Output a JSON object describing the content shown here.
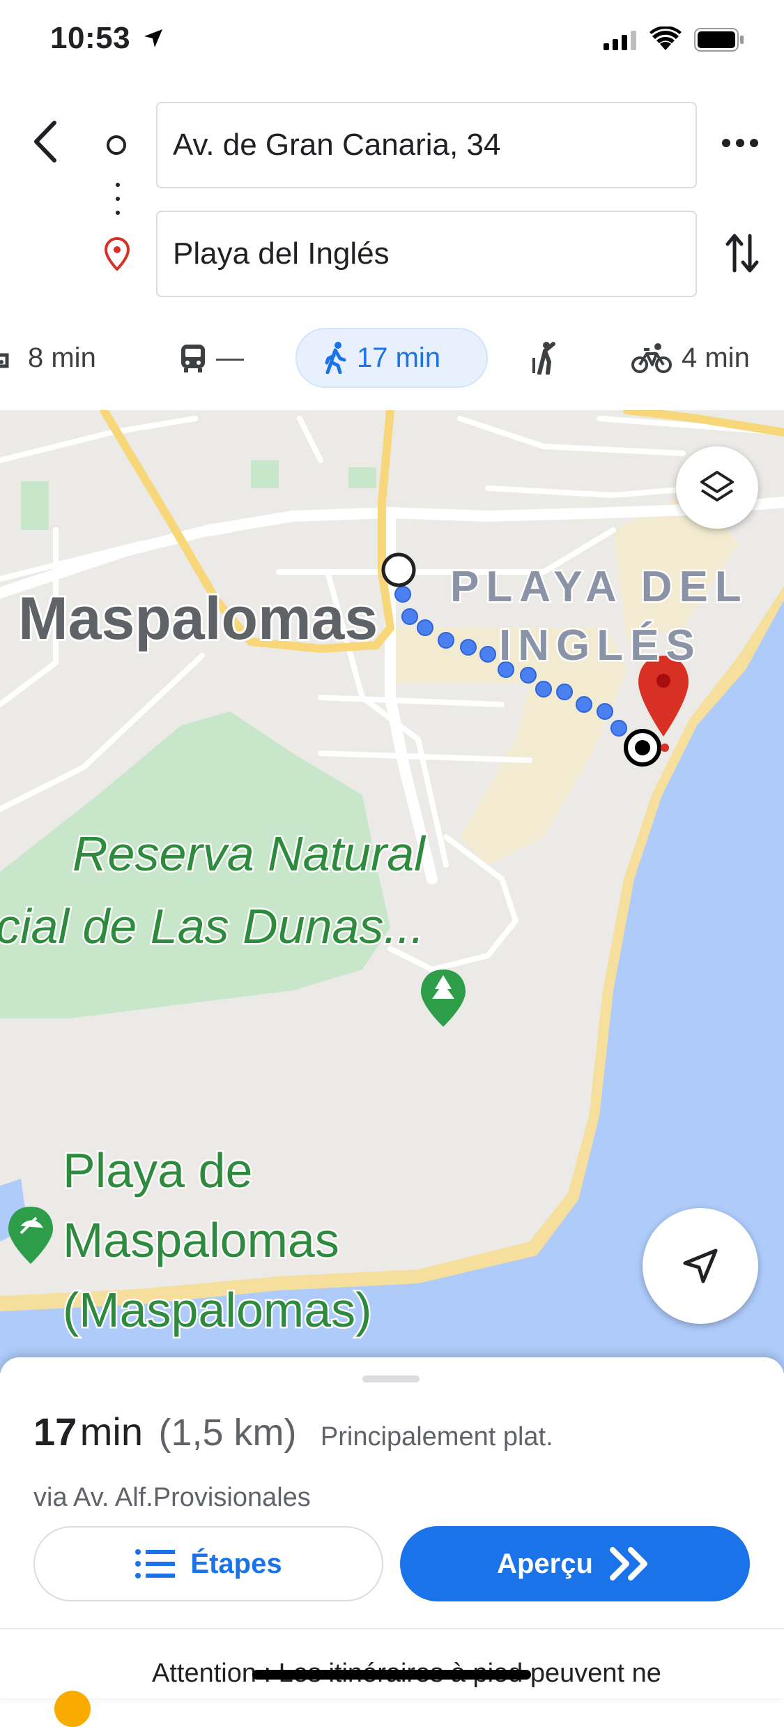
{
  "status_bar": {
    "time": "10:53"
  },
  "route": {
    "origin": "Av. de Gran Canaria, 34",
    "destination": "Playa del Inglés"
  },
  "modes": [
    {
      "icon": "car-icon",
      "label": "8 min"
    },
    {
      "icon": "transit-icon",
      "label": "—"
    },
    {
      "icon": "walk-icon",
      "label": "17 min",
      "selected": true
    },
    {
      "icon": "rideshare-icon",
      "label": ""
    },
    {
      "icon": "bike-icon",
      "label": "4 min"
    }
  ],
  "map": {
    "labels": {
      "town": "Maspalomas",
      "district_line1": "PLAYA DEL",
      "district_line2": "INGLÉS",
      "reserve_line1": "Reserva Natural",
      "reserve_line2": "cial de Las Dunas...",
      "beach_line1": "Playa de",
      "beach_line2": "Maspalomas",
      "beach_line3": "(Maspalomas)"
    }
  },
  "summary": {
    "duration_value": "17",
    "duration_unit": "min",
    "distance": "(1,5 km)",
    "terrain": "Principalement plat.",
    "via": "via Av. Alf.Provisionales",
    "steps_label": "Étapes",
    "preview_label": "Aperçu",
    "warning": "Attention : Les itinéraires à pied peuvent ne"
  },
  "colors": {
    "accent": "#1a73e8",
    "route_dots": "#4a80f0",
    "pin": "#d93025",
    "water": "#aecbfa",
    "park": "#c8e6c9",
    "road_major": "#f8d77a"
  }
}
